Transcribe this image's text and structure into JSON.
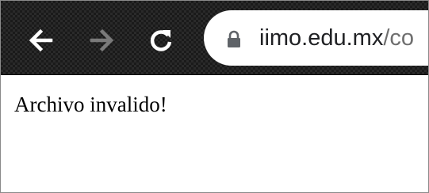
{
  "browser": {
    "toolbar": {
      "back_icon": "arrow-left-icon",
      "forward_icon": "arrow-right-icon",
      "reload_icon": "reload-icon",
      "lock_icon": "lock-icon"
    },
    "address_bar": {
      "domain": "iimo.edu.mx",
      "path": "/co"
    }
  },
  "page": {
    "message": "Archivo invalido!"
  },
  "colors": {
    "toolbar_background": "#1a1a1a",
    "icon_active": "#ffffff",
    "icon_disabled": "#7a7a7a",
    "omnibox_background": "#ffffff",
    "url_domain": "#202124",
    "url_path": "#6f6f6f"
  }
}
